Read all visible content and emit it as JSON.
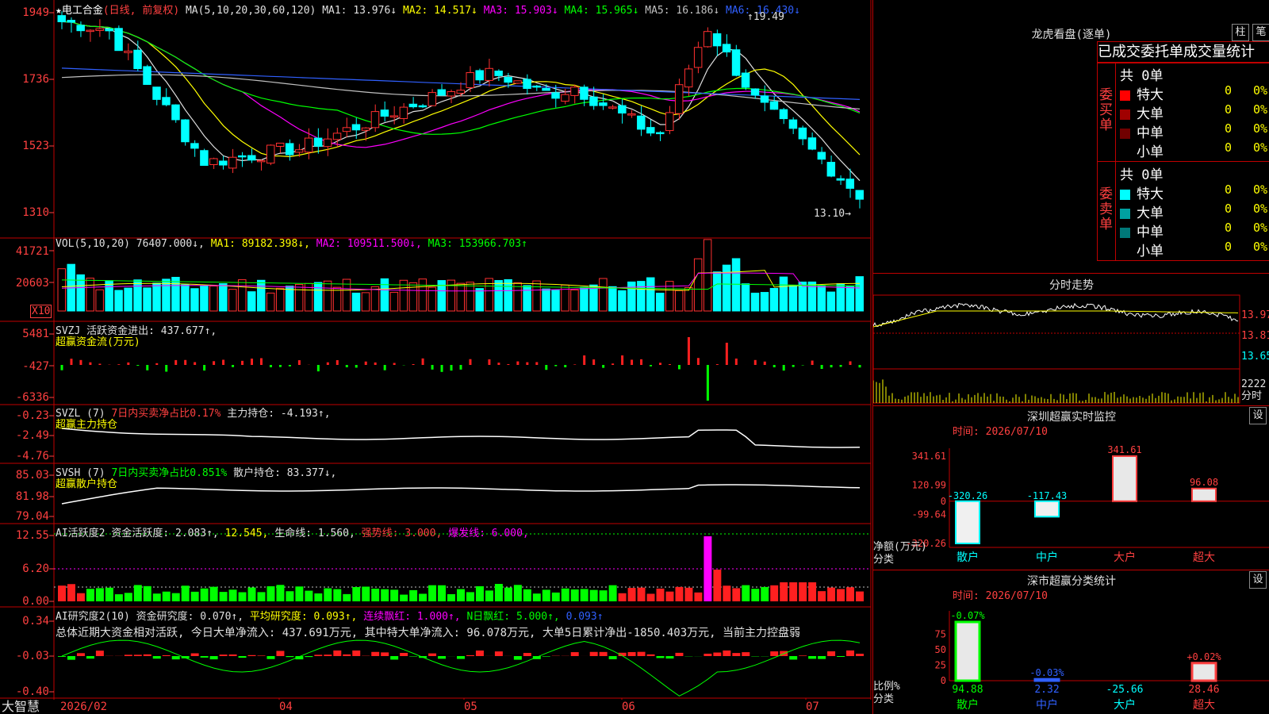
{
  "main_chart": {
    "title_prefix": "★",
    "stock_name": "电工合金",
    "period": "(日线, 前复权)",
    "ma_label": "MA(5,10,20,30,60,120)",
    "ma": [
      {
        "name": "MA1",
        "value": "13.976↓",
        "color": "#e0e0e0"
      },
      {
        "name": "MA2",
        "value": "14.517↓",
        "color": "#ffff00"
      },
      {
        "name": "MA3",
        "value": "15.903↓",
        "color": "#ff00ff"
      },
      {
        "name": "MA4",
        "value": "15.965↓",
        "color": "#00ff00"
      },
      {
        "name": "MA5",
        "value": "16.186↓",
        "color": "#c0c0c0"
      },
      {
        "name": "MA6",
        "value": "16.430↓",
        "color": "#3060ff"
      }
    ],
    "y_ticks": [
      "1949",
      "1736",
      "1523",
      "1310"
    ],
    "high_label": "19.49",
    "low_label": "13.10"
  },
  "vol_panel": {
    "label": "VOL(5,10,20)",
    "value": "76407.000↓",
    "ma1": "89182.398↓",
    "ma2": "109511.500↓",
    "ma3": "153966.703↑",
    "y_ticks": [
      "41721",
      "20603"
    ],
    "unit": "X10"
  },
  "svzj_panel": {
    "label": "SVZJ",
    "text": "活跃资金进出: 437.677↑,",
    "subtitle": "超赢资金流(万元)",
    "y_ticks": [
      "5481",
      "-427",
      "-6336"
    ]
  },
  "svzl_panel": {
    "label": "SVZL (7)",
    "text1": "7日内买卖净占比0.17%",
    "text2": "主力持仓: -4.193↑,",
    "subtitle": "超赢主力持仓",
    "y_ticks": [
      "-0.23",
      "-2.49",
      "-4.76"
    ]
  },
  "svsh_panel": {
    "label": "SVSH (7)",
    "text1": "7日内买卖净占比0.851%",
    "text2": "散户持仓: 83.377↓,",
    "subtitle": "超赢散户持仓",
    "y_ticks": [
      "85.03",
      "81.98",
      "79.04"
    ]
  },
  "ai1_panel": {
    "label": "AI活跃度2",
    "text1": "资金活跃度: 2.083↑,",
    "text2": "12.545,",
    "text3": "生命线: 1.560,",
    "text4": "强势线: 3.000,",
    "text5": "爆发线: 6.000,",
    "y_ticks": [
      "12.55",
      "6.20",
      "0.00"
    ]
  },
  "ai2_panel": {
    "label": "AI研究度2(10)",
    "text1": "资金研究度: 0.070↑,",
    "text2": "平均研究度: 0.093↑,",
    "text3": "连续飘红: 1.000↑,",
    "text4": "N日飘红: 5.000↑,",
    "text5": "0.093↑",
    "summary": "总体近期大资金相对活跃, 今日大单净流入: 437.691万元, 其中特大单净流入: 96.078万元, 大单5日累计净出-1850.403万元, 当前主力控盘弱",
    "y_ticks": [
      "0.34",
      "-0.03",
      "-0.40"
    ]
  },
  "x_axis": {
    "brand": "大智慧",
    "labels": [
      "2026/02",
      "04",
      "05",
      "06",
      "07"
    ]
  },
  "right_panel": {
    "top_title": "龙虎看盘(逐单)",
    "btn1": "柱",
    "btn2": "笔",
    "tabs": "已成交委托单成交量统计",
    "buy": {
      "side_label": "委买单",
      "total": "共 0单",
      "rows": [
        {
          "name": "特大",
          "count": "0",
          "pct": "0%",
          "color": "#ff0000"
        },
        {
          "name": "大单",
          "count": "0",
          "pct": "0%",
          "color": "#a00000"
        },
        {
          "name": "中单",
          "count": "0",
          "pct": "0%",
          "color": "#700000"
        },
        {
          "name": "小单",
          "count": "0",
          "pct": "0%",
          "color": "#000000"
        }
      ]
    },
    "sell": {
      "side_label": "委卖单",
      "total": "共 0单",
      "rows": [
        {
          "name": "特大",
          "count": "0",
          "pct": "0%",
          "color": "#00ffff"
        },
        {
          "name": "大单",
          "count": "0",
          "pct": "0%",
          "color": "#00a0a0"
        },
        {
          "name": "中单",
          "count": "0",
          "pct": "0%",
          "color": "#007878"
        },
        {
          "name": "小单",
          "count": "0",
          "pct": "0%",
          "color": "#000000"
        }
      ]
    },
    "intraday": {
      "title": "分时走势",
      "y_ticks": [
        "13.97",
        "13.81",
        "13.65"
      ],
      "vol_label": "2222",
      "vol_unit": "分时"
    },
    "monitor": {
      "title": "深圳超赢实时监控",
      "btn": "设",
      "time": "时间: 2026/07/10",
      "y_ticks": [
        "341.61",
        "120.99",
        "0",
        "-99.64",
        "-320.26"
      ],
      "y_title": "净额(万元)",
      "x_title": "分类",
      "categories": [
        "散户",
        "中户",
        "大户",
        "超大"
      ],
      "values": [
        -320.26,
        -117.43,
        341.61,
        96.08
      ],
      "value_labels": [
        "-320.26",
        "-117.43",
        "341.61",
        "96.08"
      ]
    },
    "classify": {
      "title": "深市超赢分类统计",
      "btn": "设",
      "time": "时间: 2026/07/10",
      "y_ticks": [
        "75",
        "50",
        "25",
        "0"
      ],
      "y_title": "比例%",
      "x_title": "分类",
      "categories": [
        "散户",
        "中户",
        "大户",
        "超大"
      ],
      "values": [
        94.88,
        2.32,
        -25.66,
        28.46
      ],
      "value_labels": [
        "94.88",
        "2.32",
        "-25.66",
        "28.46"
      ],
      "change_labels": [
        "-0.07%",
        "-0.03%",
        "",
        "+0.02%"
      ]
    }
  },
  "chart_data": {
    "type": "candlestick",
    "title": "电工合金 (日线, 前复权)",
    "price_range": [
      13.1,
      19.49
    ],
    "x_labels": [
      "2026/02",
      "04",
      "05",
      "06",
      "07"
    ],
    "monitor_net_amount": {
      "categories": [
        "散户",
        "中户",
        "大户",
        "超大"
      ],
      "values": [
        -320.26,
        -117.43,
        341.61,
        96.08
      ],
      "unit": "万元"
    },
    "classify_ratio": {
      "categories": [
        "散户",
        "中户",
        "大户",
        "超大"
      ],
      "values": [
        94.88,
        2.32,
        -25.66,
        28.46
      ],
      "unit": "%"
    }
  }
}
